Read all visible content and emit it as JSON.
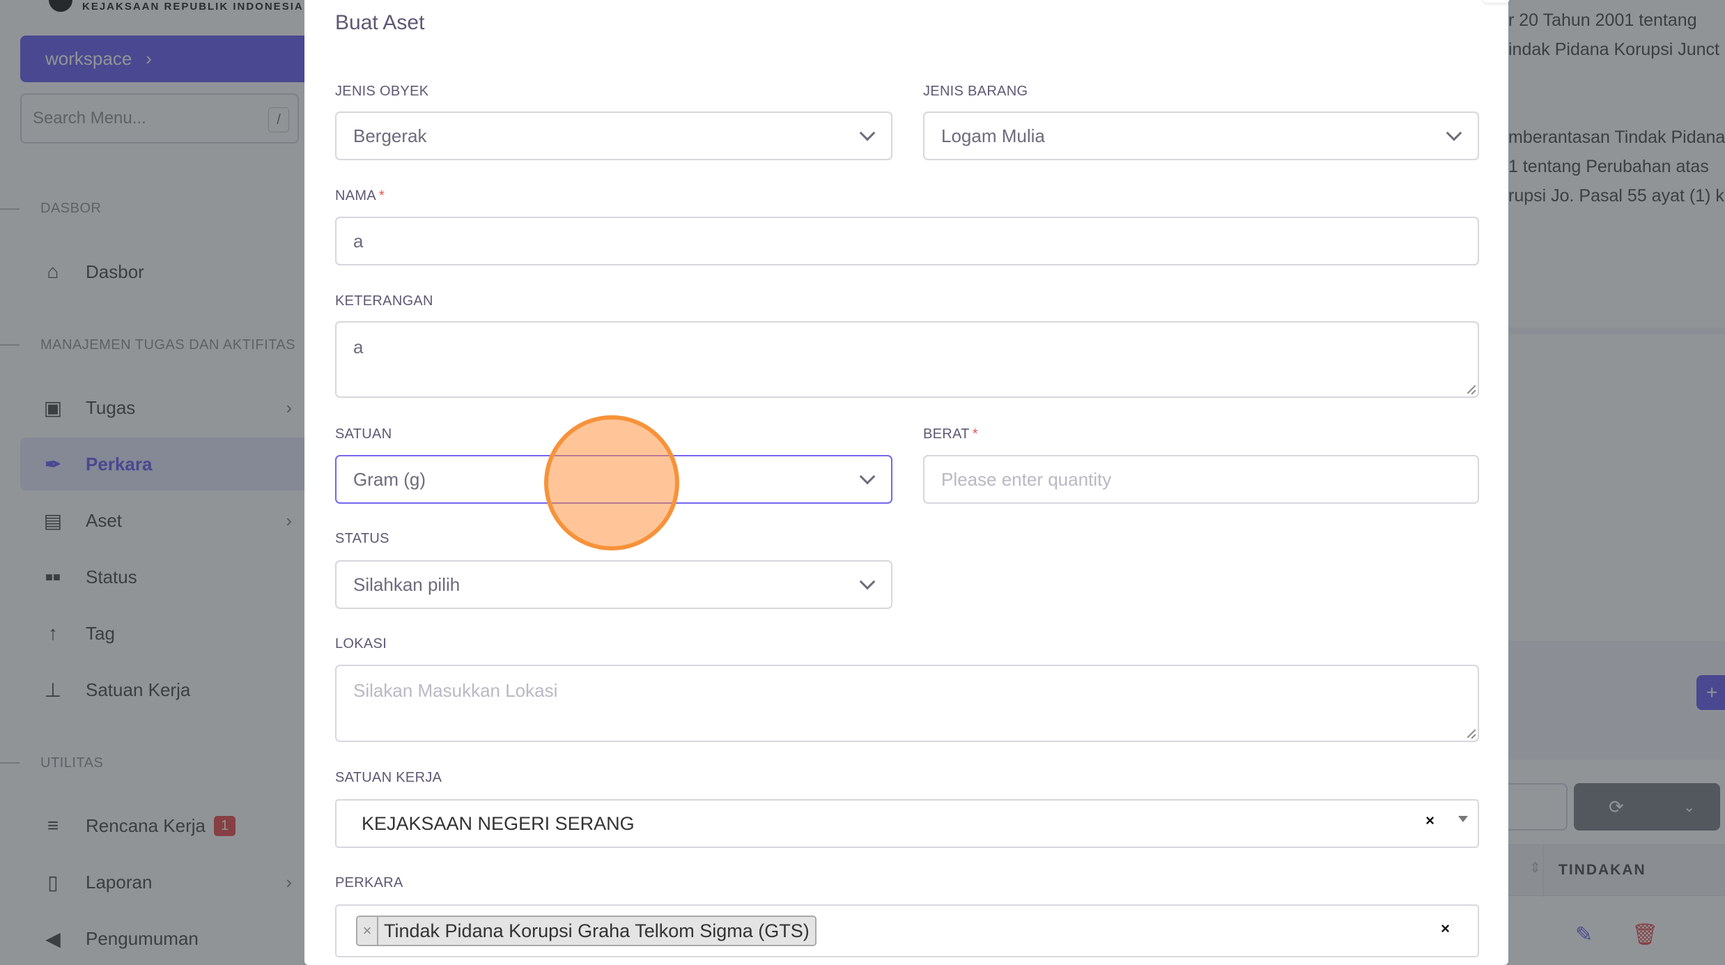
{
  "brand": {
    "text": "KEJAKSAAN REPUBLIK INDONESIA"
  },
  "sidebar": {
    "workspace_label": "workspace",
    "search_placeholder": "Search Menu...",
    "search_shortcut": "/",
    "sections": [
      {
        "label": "DASBOR"
      },
      {
        "label": "MANAJEMEN TUGAS DAN AKTIFITAS"
      },
      {
        "label": "UTILITAS"
      }
    ],
    "items": [
      {
        "label": "Dasbor",
        "icon": "home-icon"
      },
      {
        "label": "Tugas",
        "icon": "briefcase-icon"
      },
      {
        "label": "Perkara",
        "icon": "feather-pen-icon",
        "active": true
      },
      {
        "label": "Aset",
        "icon": "archive-icon"
      },
      {
        "label": "Status",
        "icon": "grid-icon"
      },
      {
        "label": "Tag",
        "icon": "arrow-up-icon"
      },
      {
        "label": "Satuan Kerja",
        "icon": "org-chart-icon"
      },
      {
        "label": "Rencana Kerja",
        "icon": "list-icon",
        "badge": "1"
      },
      {
        "label": "Laporan",
        "icon": "file-text-icon"
      },
      {
        "label": "Pengumuman",
        "icon": "megaphone-icon"
      }
    ]
  },
  "background": {
    "text_lines": [
      "r 20 Tahun 2001 tentang",
      "indak Pidana Korupsi Junct",
      "",
      "",
      "mberantasan Tindak Pidana",
      "1 tentang Perubahan atas",
      "rupsi Jo. Pasal 55 ayat (1) ke"
    ],
    "add_button_label": "+",
    "table_header_label": "TINDAKAN"
  },
  "modal": {
    "title": "Buat Aset",
    "fields": {
      "jenis_obyek": {
        "label": "JENIS OBYEK",
        "value": "Bergerak"
      },
      "jenis_barang": {
        "label": "JENIS BARANG",
        "value": "Logam Mulia"
      },
      "nama": {
        "label": "NAMA",
        "required_mark": "*",
        "value": "a"
      },
      "keterangan": {
        "label": "KETERANGAN",
        "value": "a"
      },
      "satuan": {
        "label": "SATUAN",
        "value": "Gram (g)"
      },
      "berat": {
        "label": "BERAT",
        "required_mark": "*",
        "placeholder": "Please enter quantity"
      },
      "status": {
        "label": "STATUS",
        "value": "Silahkan pilih"
      },
      "lokasi": {
        "label": "LOKASI",
        "placeholder": "Silakan Masukkan Lokasi"
      },
      "satuan_kerja": {
        "label": "SATUAN KERJA",
        "value": "KEJAKSAAN NEGERI SERANG",
        "clear_symbol": "×"
      },
      "perkara": {
        "label": "PERKARA",
        "tag": "Tindak Pidana Korupsi Graha Telkom Sigma (GTS)",
        "tag_remove_symbol": "×",
        "clear_symbol": "×"
      }
    }
  },
  "colors": {
    "primary": "#7367f0",
    "danger": "#ea5455",
    "click_indicator": "#f7923a"
  }
}
